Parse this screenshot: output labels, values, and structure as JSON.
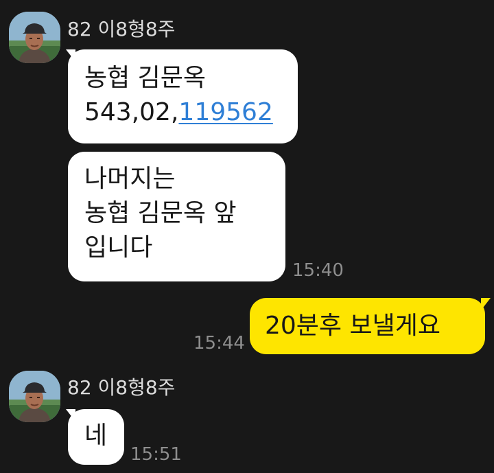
{
  "messages": {
    "group1": {
      "sender": "82 이8형8주",
      "avatar_icon": "profile-photo",
      "bubble1": {
        "line1": "농협 김문옥",
        "line2_prefix": "543,02,",
        "line2_link": "119562"
      },
      "bubble2": {
        "line1": "나머지는",
        "line2": "농협 김문옥 앞",
        "line3": "입니다"
      },
      "time": "15:40"
    },
    "outgoing": {
      "text": "20분후 보낼게요",
      "time": "15:44"
    },
    "group2": {
      "sender": "82 이8형8주",
      "avatar_icon": "profile-photo",
      "bubble1": {
        "text": "네"
      },
      "time": "15:51"
    }
  },
  "colors": {
    "background": "#181818",
    "incoming_bubble": "#ffffff",
    "outgoing_bubble": "#fee500",
    "link": "#2f7fd6",
    "timestamp": "#8e8e8e"
  }
}
